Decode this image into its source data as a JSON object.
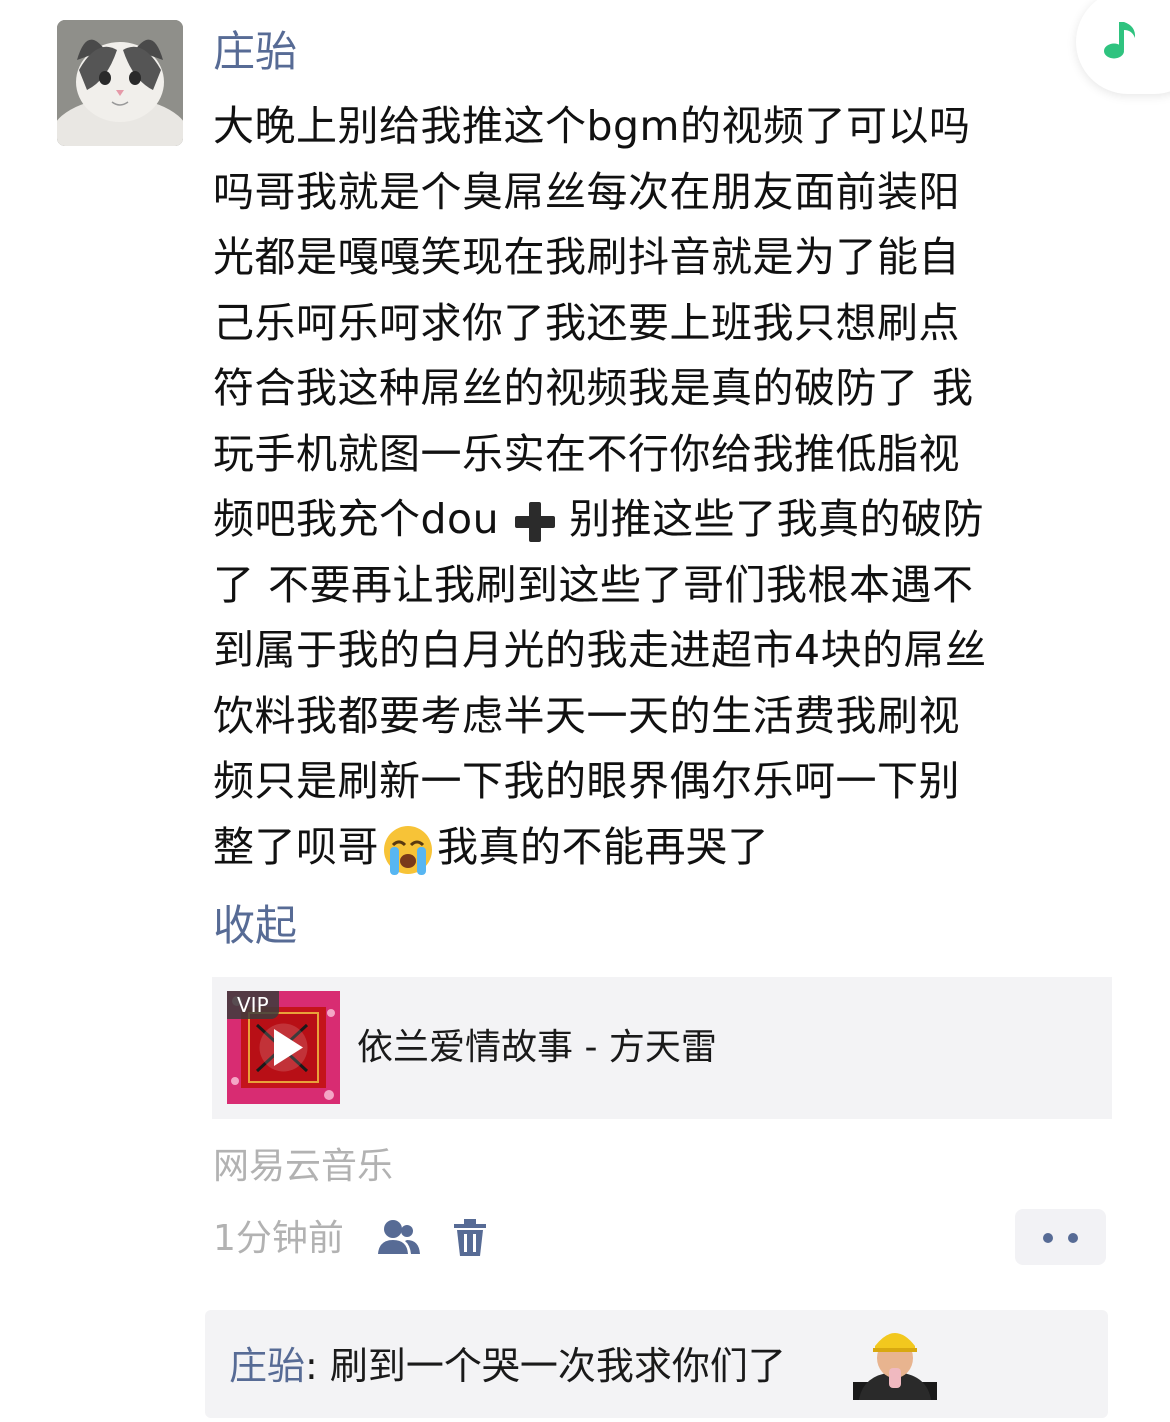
{
  "post": {
    "author": "庄骀",
    "text_lines": [
      "大晚上别给我推这个bgm的视频了可以吗",
      "吗哥我就是个臭屌丝每次在朋友面前装阳",
      "光都是嘎嘎笑现在我刷抖音就是为了能自",
      "己乐呵乐呵求你了我还要上班我只想刷点",
      "符合我这种屌丝的视频我是真的破防了 我",
      "玩手机就图一乐实在不行你给我推低脂视"
    ],
    "line7_before": "频吧我充个dou",
    "line7_after": "别推这些了我真的破防",
    "text_lines_b": [
      "了 不要再让我刷到这些了哥们我根本遇不",
      "到属于我的白月光的我走进超市4块的屌丝",
      "饮料我都要考虑半天一天的生活费我刷视",
      "频只是刷新一下我的眼界偶尔乐呵一下别"
    ],
    "last_line_before": "整了呗哥",
    "last_line_after": "我真的不能再哭了",
    "collapse_label": "收起",
    "share": {
      "vip_label": "VIP",
      "song": "依兰爱情故事 - 方天雷"
    },
    "source": "网易云音乐",
    "time": "1分钟前"
  },
  "comment": {
    "author": "庄骀",
    "separator": ": ",
    "text": "刷到一个哭一次我求你们了"
  },
  "icons": {
    "music": "music-note-icon",
    "visibility": "people-icon",
    "delete": "trash-icon",
    "more": "more-dots-icon",
    "plus_emoji": "heavy-plus-emoji",
    "cry_emoji": "loudly-crying-face-emoji"
  },
  "colors": {
    "link_blue": "#576b95",
    "music_green": "#2fc37f",
    "card_bg": "#f3f3f5",
    "secondary_text": "#b2b2b2"
  }
}
